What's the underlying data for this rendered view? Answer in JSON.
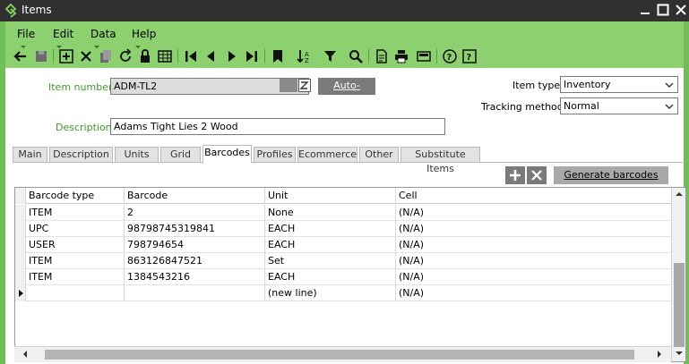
{
  "window": {
    "title": "Items"
  },
  "menu": [
    {
      "label": "File"
    },
    {
      "label": "Edit"
    },
    {
      "label": "Data"
    },
    {
      "label": "Help"
    }
  ],
  "toolbar_icons": [
    "back-arrow-icon",
    "save-icon",
    "add-icon",
    "delete-icon",
    "copy-icon",
    "refresh-icon",
    "lock-icon",
    "grid-icon",
    "first-record-icon",
    "previous-record-icon",
    "next-record-icon",
    "last-record-icon",
    "bookmark-icon",
    "sort-icon",
    "filter-icon",
    "search-icon",
    "document-icon",
    "print-icon",
    "calculator-icon",
    "help-icon",
    "about-icon"
  ],
  "form": {
    "item_number_label": "Item number",
    "item_number_value": "ADM-TL2",
    "auto_assign_label": "Auto-assign",
    "description_label": "Description",
    "description_value": "Adams Tight Lies 2 Wood",
    "item_type_label": "Item type",
    "item_type_value": "Inventory",
    "tracking_method_label": "Tracking method",
    "tracking_method_value": "Normal"
  },
  "tabs": [
    {
      "label": "Main"
    },
    {
      "label": "Description"
    },
    {
      "label": "Units"
    },
    {
      "label": "Grid"
    },
    {
      "label": "Barcodes",
      "active": true
    },
    {
      "label": "Profiles"
    },
    {
      "label": "Ecommerce"
    },
    {
      "label": "Other"
    },
    {
      "label": "Substitute Items"
    }
  ],
  "grid_actions": {
    "generate_label": "Generate barcodes"
  },
  "grid": {
    "columns": [
      "Barcode type",
      "Barcode",
      "Unit",
      "Cell"
    ],
    "rows": [
      [
        "ITEM",
        "2",
        "None",
        "(N/A)"
      ],
      [
        "UPC",
        "98798745319841",
        "EACH",
        "(N/A)"
      ],
      [
        "USER",
        "798794654",
        "EACH",
        "(N/A)"
      ],
      [
        "ITEM",
        "863126847521",
        "Set",
        "(N/A)"
      ],
      [
        "ITEM",
        "1384543216",
        "EACH",
        "(N/A)"
      ],
      [
        "",
        "",
        "(new line)",
        "(N/A)"
      ]
    ]
  },
  "colors": {
    "accent": "#8dd06f",
    "accent_dark": "#6fbe58",
    "label_green": "#3e9b2b",
    "titlebar": "#303030"
  }
}
